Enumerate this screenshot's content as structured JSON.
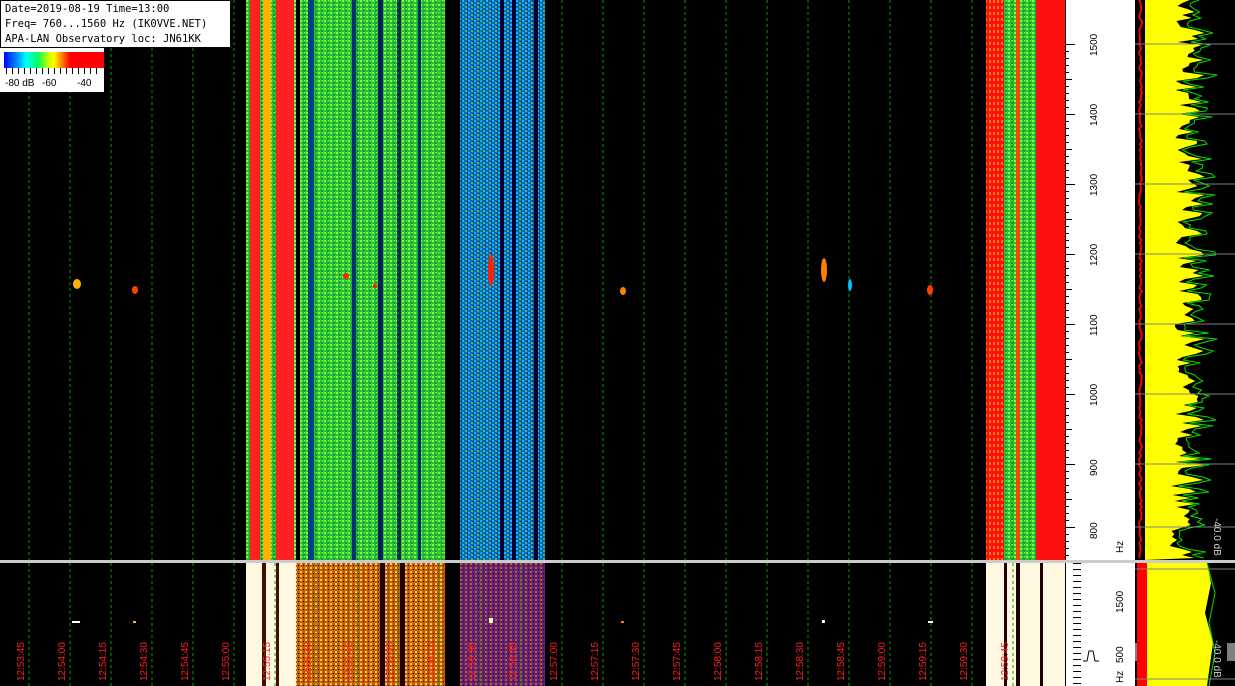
{
  "header": {
    "line1": "Date=2019-08-19 Time=13:00",
    "line2": "Freq= 760...1560 Hz (IK0VVE.NET)",
    "line3": "APA-LAN Observatory loc: JN61KK"
  },
  "scale": {
    "label_low": "-80 dB",
    "label_mid": "-60",
    "label_high": "-40"
  },
  "freq_axis": {
    "ticks": [
      "1500",
      "1400",
      "1300",
      "1200",
      "1100",
      "1000",
      "900",
      "800"
    ],
    "unit": "Hz",
    "lower_ticks": [
      "1500",
      "500"
    ],
    "lower_unit": "Hz"
  },
  "power_axis": {
    "upper_label": "-40.0 dB",
    "lower_label": "-40.0 dB"
  },
  "time_axis": {
    "labels": [
      "12:53:45",
      "12:54:00",
      "12:54:15",
      "12:54:30",
      "12:54:45",
      "12:55:00",
      "12:55:15",
      "12:55:30",
      "12:55:45",
      "12:56:00",
      "12:56:15",
      "12:56:30",
      "12:56:45",
      "12:57:00",
      "12:57:15",
      "12:57:30",
      "12:57:45",
      "12:58:00",
      "12:58:15",
      "12:58:30",
      "12:58:45",
      "12:59:00",
      "12:59:15",
      "12:59:30",
      "12:59:45"
    ]
  },
  "colors": {
    "time_label": "#ff2020",
    "grid": "#00a000",
    "trace_yellow": "#ffff00",
    "trace_green": "#00e000",
    "trace_red": "#ff0000"
  }
}
